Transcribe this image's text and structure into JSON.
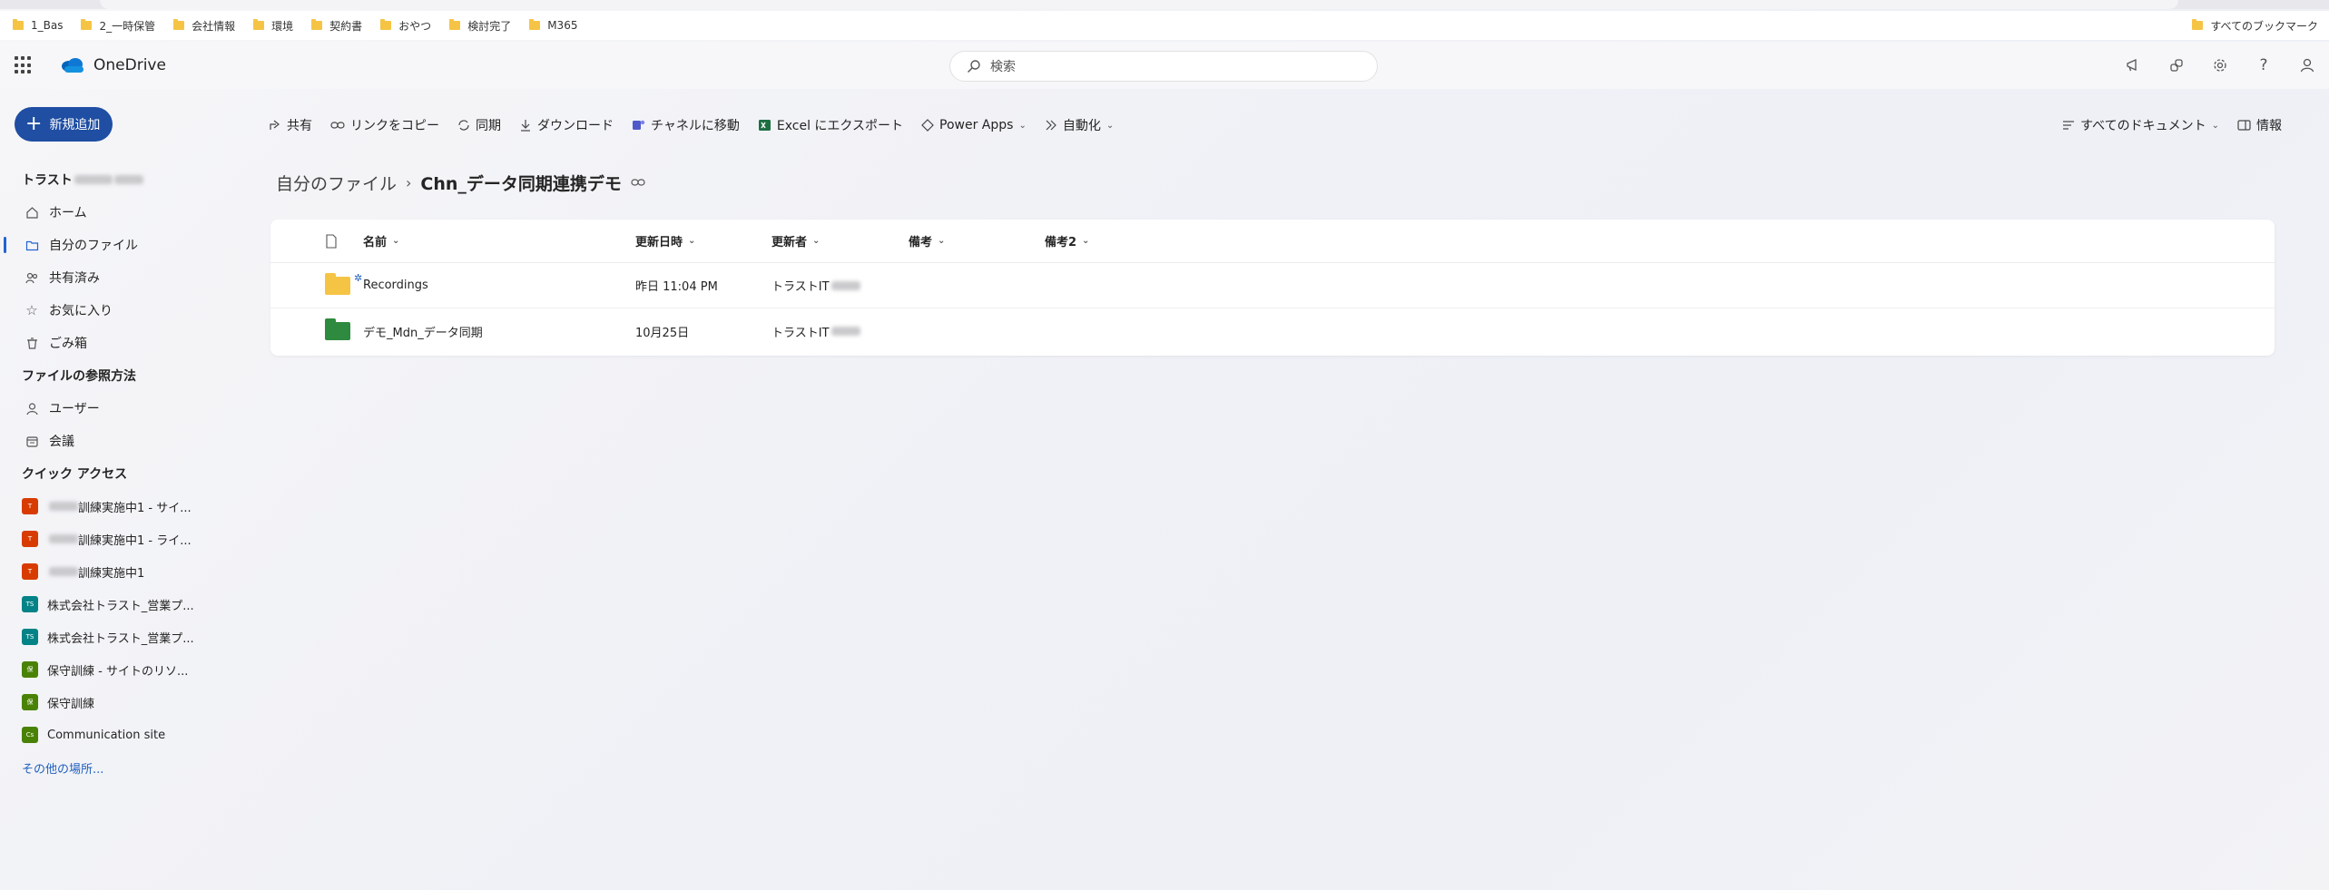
{
  "bookmarks": {
    "items": [
      "1_Bas",
      "2_一時保管",
      "会社情報",
      "環境",
      "契約書",
      "おやつ",
      "検討完了",
      "M365"
    ],
    "right_label": "すべてのブックマーク"
  },
  "app": {
    "name": "OneDrive",
    "search_placeholder": "検索",
    "header_icons": [
      "megaphone-icon",
      "share-icon",
      "gear-icon",
      "help-icon",
      "person-icon"
    ]
  },
  "new_button": {
    "label": "新規追加"
  },
  "sidebar": {
    "user_name": "トラスト",
    "items": [
      {
        "label": "ホーム",
        "icon": "home-icon"
      },
      {
        "label": "自分のファイル",
        "icon": "folder-icon",
        "selected": true
      },
      {
        "label": "共有済み",
        "icon": "people-icon"
      },
      {
        "label": "お気に入り",
        "icon": "star-icon"
      },
      {
        "label": "ごみ箱",
        "icon": "trash-icon"
      }
    ],
    "browse_heading": "ファイルの参照方法",
    "browse_items": [
      {
        "label": "ユーザー",
        "icon": "person-icon"
      },
      {
        "label": "会議",
        "icon": "calendar-icon"
      }
    ],
    "quick_heading": "クイック アクセス",
    "quick_items": [
      {
        "label": "訓練実施中1 - サイ...",
        "badge": "T",
        "color": "#d83b01",
        "blurred_prefix": true
      },
      {
        "label": "訓練実施中1 - ライ...",
        "badge": "T",
        "color": "#d83b01",
        "blurred_prefix": true
      },
      {
        "label": "訓練実施中1",
        "badge": "T",
        "color": "#d83b01",
        "blurred_prefix": true
      },
      {
        "label": "株式会社トラスト_営業プ...",
        "badge": "TS",
        "color": "#038387",
        "blurred_prefix": false
      },
      {
        "label": "株式会社トラスト_営業プ...",
        "badge": "TS",
        "color": "#038387",
        "blurred_prefix": false
      },
      {
        "label": "保守訓練 - サイトのリソ...",
        "badge": "保",
        "color": "#498205",
        "blurred_prefix": false
      },
      {
        "label": "保守訓練",
        "badge": "保",
        "color": "#498205",
        "blurred_prefix": false
      },
      {
        "label": "Communication site",
        "badge": "Cs",
        "color": "#498205",
        "blurred_prefix": false
      }
    ],
    "more_link": "その他の場所..."
  },
  "commands": {
    "left": [
      {
        "label": "共有",
        "icon": "share-icon"
      },
      {
        "label": "リンクをコピー",
        "icon": "link-icon"
      },
      {
        "label": "同期",
        "icon": "sync-icon"
      },
      {
        "label": "ダウンロード",
        "icon": "download-icon"
      },
      {
        "label": "チャネルに移動",
        "icon": "teams-icon"
      },
      {
        "label": "Excel にエクスポート",
        "icon": "excel-icon"
      },
      {
        "label": "Power Apps",
        "icon": "powerapps-icon",
        "dropdown": true
      },
      {
        "label": "自動化",
        "icon": "automate-icon",
        "dropdown": true
      }
    ],
    "view_label": "すべてのドキュメント",
    "info_label": "情報"
  },
  "breadcrumb": {
    "root": "自分のファイル",
    "current": "Chn_データ同期連携デモ"
  },
  "file_list": {
    "columns": {
      "name": "名前",
      "modified": "更新日時",
      "modified_by": "更新者",
      "note": "備考",
      "note2": "備考2"
    },
    "rows": [
      {
        "name": "Recordings",
        "modified": "昨日 11:04 PM",
        "modified_by": "トラストIT",
        "folder_color": "yellow",
        "new": true
      },
      {
        "name": "デモ_Mdn_データ同期",
        "modified": "10月25日",
        "modified_by": "トラストIT",
        "folder_color": "green",
        "new": false
      }
    ]
  }
}
